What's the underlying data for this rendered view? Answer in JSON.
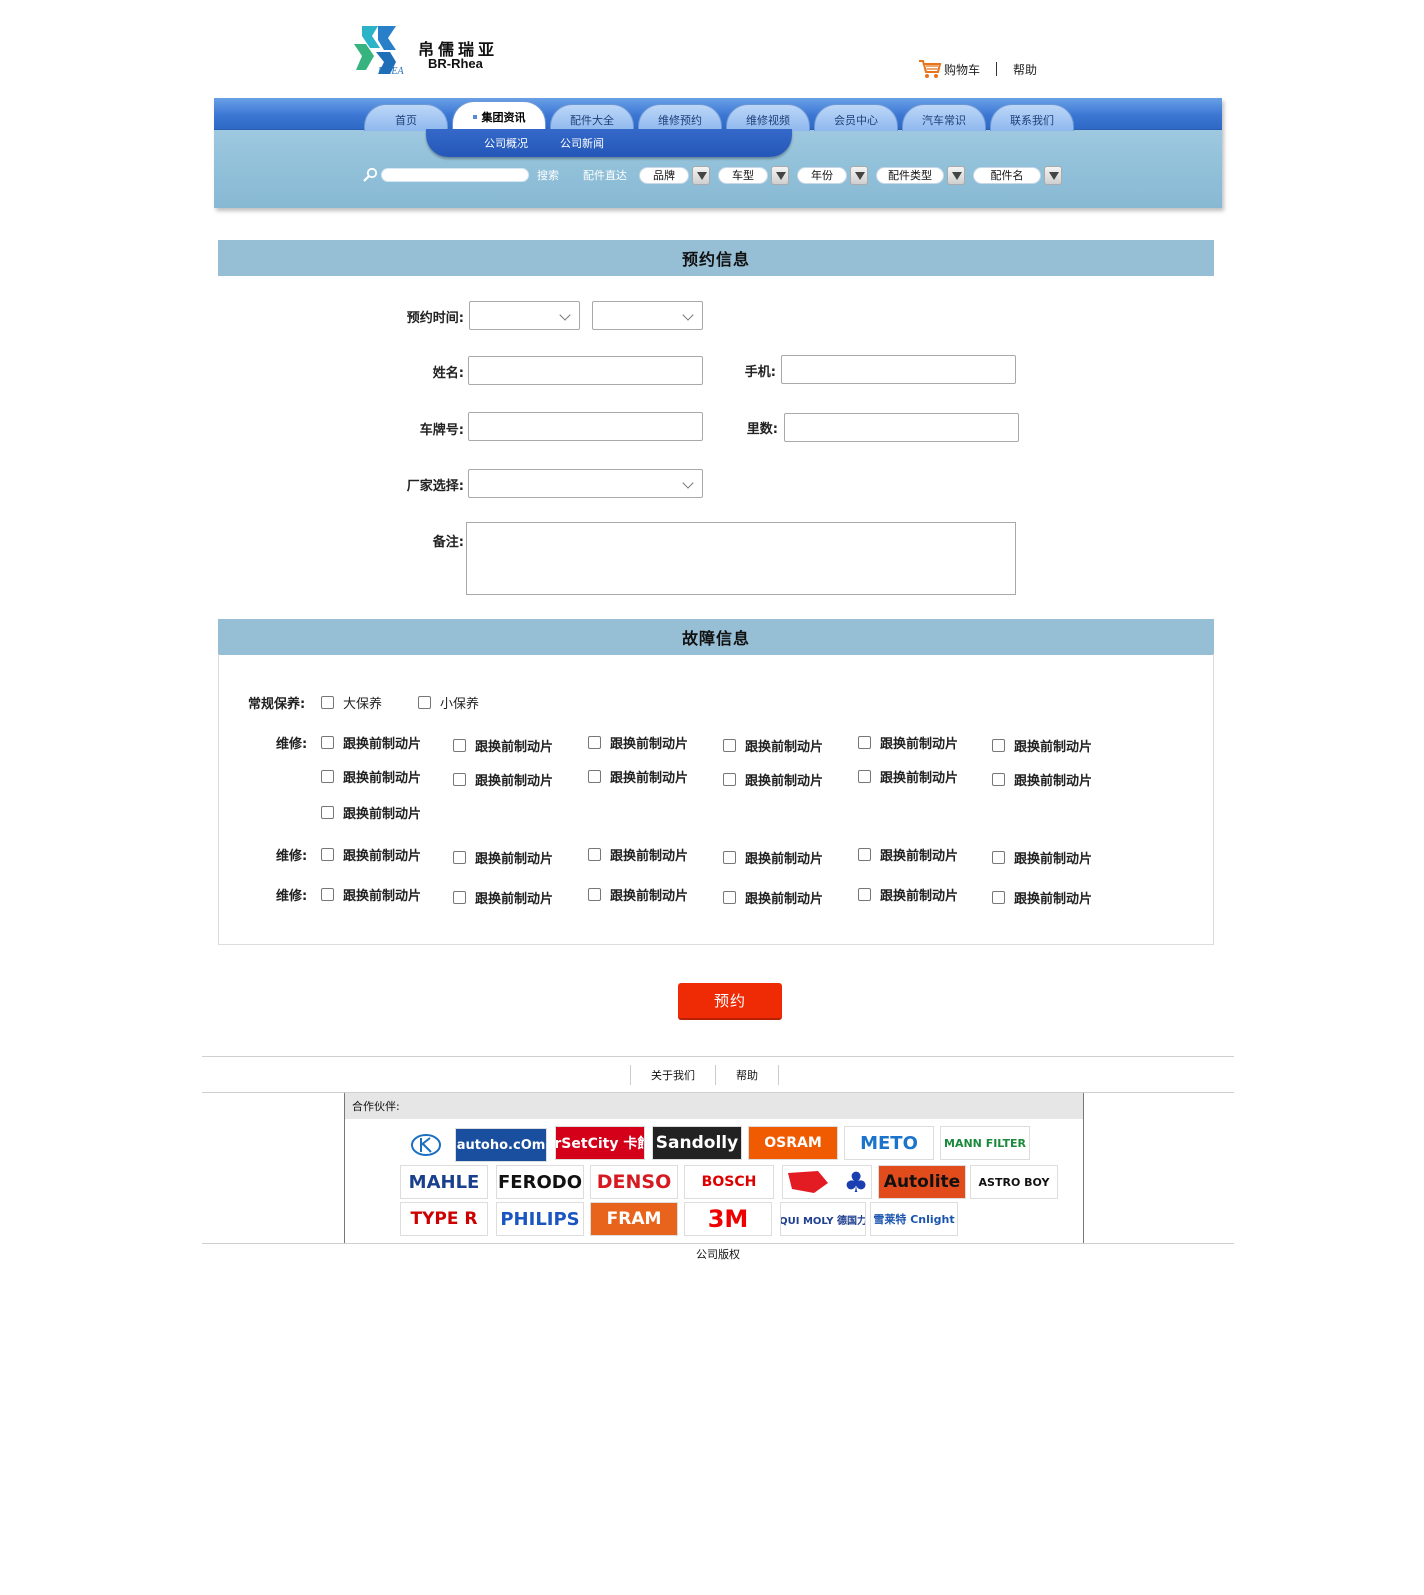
{
  "brand": {
    "cn": "帛儒瑞亚",
    "en": "BR-Rhea",
    "mark": "RHEA"
  },
  "header": {
    "cart": "购物车",
    "help": "帮助"
  },
  "nav": {
    "tabs": [
      {
        "label": "首页",
        "active": false
      },
      {
        "label": "集团资讯",
        "active": true
      },
      {
        "label": "配件大全",
        "active": false
      },
      {
        "label": "维修预约",
        "active": false
      },
      {
        "label": "维修视频",
        "active": false
      },
      {
        "label": "会员中心",
        "active": false
      },
      {
        "label": "汽车常识",
        "active": false
      },
      {
        "label": "联系我们",
        "active": false
      }
    ],
    "subnav": [
      "公司概况",
      "公司新闻"
    ],
    "search_button": "搜索",
    "direct_label": "配件直达",
    "filters": [
      "品牌",
      "车型",
      "年份",
      "配件类型",
      "配件名"
    ]
  },
  "booking": {
    "title": "预约信息",
    "time_label": "预约时间:",
    "name_label": "姓名:",
    "phone_label": "手机:",
    "plate_label": "车牌号:",
    "mileage_label": "里数:",
    "maker_label": "厂家选择:",
    "note_label": "备注:"
  },
  "fault": {
    "title": "故障信息",
    "routine_label": "常规保养:",
    "routine_options": [
      "大保养",
      "小保养"
    ],
    "repair_label": "维修:",
    "repair_option": "跟换前制动片"
  },
  "submit_label": "预约",
  "footer": {
    "links": [
      "关于我们",
      "帮助"
    ],
    "partners_label": "合作伙伴:",
    "partners": [
      "autoho.cOm",
      "CarSetCity 卡飾社",
      "Sandolly",
      "OSRAM",
      "METO",
      "MANN FILTER",
      "MAHLE",
      "FERODO",
      "DENSO",
      "BOSCH",
      "Autolite",
      "ASTRO BOY",
      "TYPE R",
      "PHILIPS",
      "FRAM",
      "3M",
      "LIQUI MOLY 德国力魔",
      "雪莱特 Cnlight"
    ],
    "copyright": "公司版权"
  },
  "colors": {
    "nav_blue": "#3c77d4",
    "section_bg": "#96bfd6",
    "submit": "#ee2b05"
  }
}
